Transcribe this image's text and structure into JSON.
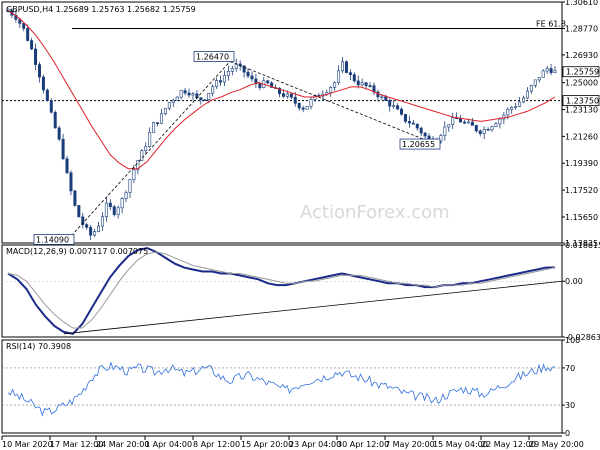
{
  "watermark": "ActionForex.com",
  "colors": {
    "candle": "#1a3d7a",
    "ema": "#e0202a",
    "macd": "#1c2a8a",
    "signal": "#999999",
    "rsi": "#3070e0",
    "frame": "#000000"
  },
  "price_panel": {
    "title": "GBPUSD,H4  1.25689 1.25763 1.25682 1.25759",
    "ticks": [
      "1.30610",
      "1.28770",
      "1.26930",
      "1.25000",
      "1.23130",
      "1.21260",
      "1.19390",
      "1.17520",
      "1.15650",
      "1.13835"
    ],
    "fe_label": "FE 61.8",
    "current_price": "1.25759",
    "level_price": "1.23750",
    "annotations": [
      "1.26470",
      "1.20655",
      "1.14090"
    ]
  },
  "macd_panel": {
    "title": "MACD(12,26,9) 0.007117 0.007075",
    "ticks": [
      "0.018615",
      "0.00",
      "-0.028631"
    ]
  },
  "rsi_panel": {
    "title": "RSI(14) 70.3908",
    "ticks": [
      "100",
      "70",
      "30",
      "0"
    ]
  },
  "x_axis": [
    "10 Mar 2020",
    "17 Mar 12:00",
    "24 Mar 20:00",
    "1 Apr 04:00",
    "8 Apr 12:00",
    "15 Apr 20:00",
    "23 Apr 04:00",
    "30 Apr 12:00",
    "7 May 20:00",
    "15 May 04:00",
    "22 May 12:00",
    "29 May 20:00"
  ],
  "chart_data": [
    {
      "type": "candlestick",
      "title": "GBPUSD,H4  1.25689 1.25763 1.25682 1.25759",
      "ylim": [
        1.1384,
        1.3061
      ],
      "x_range": [
        "10 Mar 2020",
        "2 Jun 2020"
      ],
      "close_anchors": [
        1.3,
        1.296,
        1.288,
        1.275,
        1.258,
        1.24,
        1.222,
        1.205,
        1.18,
        1.16,
        1.15,
        1.143,
        1.152,
        1.165,
        1.16,
        1.168,
        1.182,
        1.195,
        1.205,
        1.22,
        1.225,
        1.235,
        1.24,
        1.245,
        1.243,
        1.238,
        1.24,
        1.248,
        1.252,
        1.258,
        1.262,
        1.258,
        1.252,
        1.248,
        1.25,
        1.245,
        1.242,
        1.24,
        1.235,
        1.232,
        1.238,
        1.242,
        1.245,
        1.25,
        1.263,
        1.255,
        1.25,
        1.248,
        1.245,
        1.24,
        1.236,
        1.232,
        1.225,
        1.222,
        1.218,
        1.212,
        1.208,
        1.215,
        1.222,
        1.225,
        1.222,
        1.22,
        1.216,
        1.218,
        1.222,
        1.226,
        1.232,
        1.235,
        1.24,
        1.248,
        1.255,
        1.26,
        1.2576
      ],
      "last_price": 1.25759,
      "horizontal_lines": [
        {
          "label": "FE 61.8",
          "value": 1.2877,
          "style": "solid"
        },
        {
          "value": 1.2375,
          "style": "dashed"
        }
      ],
      "trendlines": [
        {
          "from": [
            1.1409,
            "19 Mar 2020"
          ],
          "to": [
            1.2647,
            "14 Apr 2020"
          ]
        },
        {
          "from": [
            1.2647,
            "14 Apr 2020"
          ],
          "to": [
            1.20655,
            "14 May 2020"
          ]
        }
      ],
      "annotations": [
        {
          "text": "1.26470",
          "value": 1.2647
        },
        {
          "text": "1.20655",
          "value": 1.20655
        },
        {
          "text": "1.14090",
          "value": 1.1409
        }
      ],
      "overlay": {
        "type": "line",
        "values": [
          1.3,
          1.296,
          1.29,
          1.283,
          1.274,
          1.264,
          1.253,
          1.242,
          1.231,
          1.22,
          1.21,
          1.2,
          1.194,
          1.19,
          1.19,
          1.195,
          1.203,
          1.211,
          1.218,
          1.224,
          1.229,
          1.234,
          1.238,
          1.24,
          1.243,
          1.245,
          1.248,
          1.25,
          1.248,
          1.246,
          1.244,
          1.242,
          1.24,
          1.24,
          1.241,
          1.243,
          1.245,
          1.247,
          1.247,
          1.245,
          1.242,
          1.24,
          1.238,
          1.236,
          1.234,
          1.232,
          1.23,
          1.228,
          1.226,
          1.225,
          1.224,
          1.223,
          1.224,
          1.225,
          1.226,
          1.228,
          1.23,
          1.233,
          1.236,
          1.24
        ]
      }
    },
    {
      "type": "line",
      "title": "MACD(12,26,9) 0.007117 0.007075",
      "ylim": [
        -0.028631,
        0.018615
      ],
      "series": [
        {
          "values": [
            0.004,
            0.001,
            -0.004,
            -0.012,
            -0.018,
            -0.023,
            -0.026,
            -0.027,
            -0.022,
            -0.014,
            -0.006,
            0.002,
            0.008,
            0.013,
            0.016,
            0.017,
            0.015,
            0.012,
            0.009,
            0.007,
            0.006,
            0.005,
            0.005,
            0.004,
            0.004,
            0.003,
            0.002,
            0.001,
            -0.001,
            -0.002,
            -0.002,
            -0.001,
            0.0,
            0.001,
            0.002,
            0.003,
            0.004,
            0.003,
            0.002,
            0.001,
            0.0,
            -0.001,
            -0.001,
            -0.002,
            -0.002,
            -0.003,
            -0.003,
            -0.002,
            -0.002,
            -0.001,
            -0.001,
            0.0,
            0.001,
            0.002,
            0.003,
            0.004,
            0.005,
            0.006,
            0.007,
            0.0071
          ]
        },
        {
          "values": [
            0.004,
            0.003,
            0.0,
            -0.006,
            -0.012,
            -0.017,
            -0.021,
            -0.024,
            -0.024,
            -0.02,
            -0.014,
            -0.007,
            0.0,
            0.006,
            0.011,
            0.014,
            0.015,
            0.014,
            0.012,
            0.01,
            0.008,
            0.007,
            0.006,
            0.005,
            0.004,
            0.004,
            0.003,
            0.002,
            0.001,
            0.0,
            -0.001,
            -0.001,
            0.0,
            0.0,
            0.001,
            0.002,
            0.003,
            0.003,
            0.003,
            0.002,
            0.001,
            0.0,
            -0.001,
            -0.001,
            -0.002,
            -0.002,
            -0.003,
            -0.002,
            -0.002,
            -0.002,
            -0.001,
            -0.001,
            0.0,
            0.001,
            0.002,
            0.003,
            0.004,
            0.005,
            0.006,
            0.00707
          ]
        }
      ],
      "trendline": {
        "from": [
          -0.027,
          "17 Mar 2020"
        ],
        "to": [
          0.0,
          "2 Jun 2020"
        ]
      }
    },
    {
      "type": "line",
      "title": "RSI(14) 70.3908",
      "ylim": [
        0,
        100
      ],
      "levels": [
        70,
        30
      ],
      "series": [
        {
          "values": [
            45,
            40,
            35,
            28,
            22,
            25,
            30,
            35,
            45,
            60,
            68,
            72,
            70,
            66,
            70,
            68,
            65,
            70,
            68,
            64,
            66,
            70,
            68,
            60,
            56,
            60,
            62,
            58,
            54,
            50,
            46,
            50,
            55,
            58,
            60,
            64,
            66,
            62,
            60,
            56,
            52,
            50,
            46,
            42,
            40,
            38,
            34,
            40,
            44,
            48,
            46,
            42,
            44,
            50,
            55,
            60,
            64,
            68,
            72,
            70.39
          ]
        }
      ]
    }
  ]
}
